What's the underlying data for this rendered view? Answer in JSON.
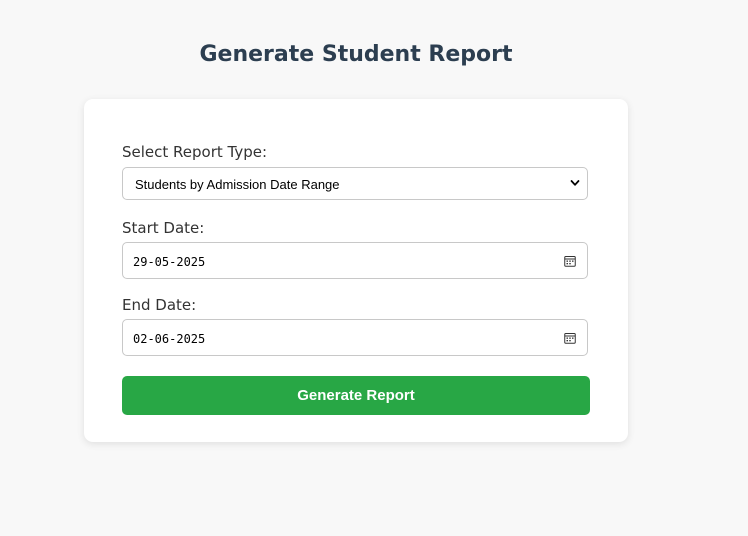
{
  "page": {
    "title": "Generate Student Report"
  },
  "form": {
    "report_type": {
      "label": "Select Report Type:",
      "selected": "Students by Admission Date Range",
      "icon": "chevron-down-icon"
    },
    "start_date": {
      "label": "Start Date:",
      "value": "29-05-2025",
      "icon": "calendar-icon"
    },
    "end_date": {
      "label": "End Date:",
      "value": "02-06-2025",
      "icon": "calendar-icon"
    },
    "submit_label": "Generate Report"
  },
  "colors": {
    "background": "#f8f8f8",
    "title": "#2c3e50",
    "button": "#28a745",
    "button_text": "#ffffff",
    "border": "#c8c8c8"
  }
}
